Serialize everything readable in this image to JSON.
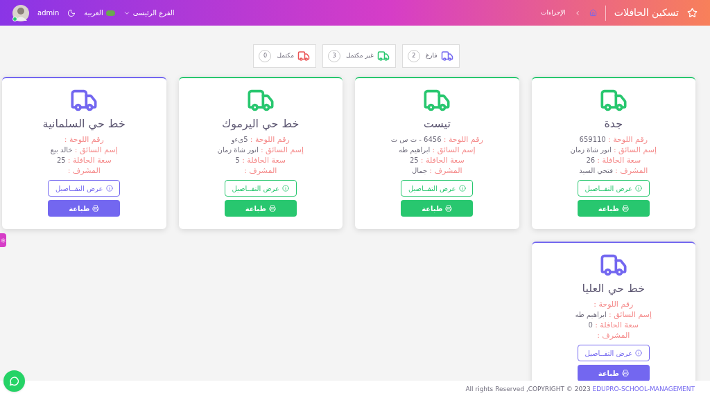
{
  "header": {
    "title": "تسكين الحافلات",
    "breadcrumb": "الإجراءات",
    "branch": "الفرع الرئيسى",
    "language": "العربية",
    "user": "admin"
  },
  "summary": [
    {
      "label": "فارغ",
      "count": "2",
      "color": "#7367f0"
    },
    {
      "label": "غير مكتمل",
      "count": "3",
      "color": "#28c76f"
    },
    {
      "label": "مكتمل",
      "count": "0",
      "color": "#ea5455"
    }
  ],
  "buses": [
    {
      "name": "جدة",
      "color": "#28c76f",
      "fields": [
        {
          "label": "رقم اللوحة :",
          "value": "659110"
        },
        {
          "label": "إسم السائق :",
          "value": "انور شاة زمان"
        },
        {
          "label": "سعة الحافلة :",
          "value": "26"
        },
        {
          "label": "المشرف :",
          "value": "فتحي السيد"
        }
      ],
      "details": "عرض التفــاصيل",
      "print": "طباعة"
    },
    {
      "name": "تيست",
      "color": "#28c76f",
      "fields": [
        {
          "label": "رقم اللوحة :",
          "value": "6456 - ت س ت"
        },
        {
          "label": "إسم السائق :",
          "value": "ابراهيم طه"
        },
        {
          "label": "سعة الحافلة :",
          "value": "25"
        },
        {
          "label": "المشرف :",
          "value": "جمال"
        }
      ],
      "details": "عرض التفــاصيل",
      "print": "طباعة"
    },
    {
      "name": "خط حي اليرموك",
      "color": "#28c76f",
      "fields": [
        {
          "label": "رقم اللوحة :",
          "value": "5ىءو"
        },
        {
          "label": "إسم السائق :",
          "value": "انور شاة زمان"
        },
        {
          "label": "سعة الحافلة :",
          "value": "5"
        },
        {
          "label": "المشرف :"
        }
      ],
      "details": "عرض التفــاصيل",
      "print": "طباعة"
    },
    {
      "name": "خط حي السلمانية",
      "color": "#7367f0",
      "fields": [
        {
          "label": "رقم اللوحة :"
        },
        {
          "label": "إسم السائق :",
          "value": "خالد بيع"
        },
        {
          "label": "سعة الحافلة :",
          "value": "25"
        },
        {
          "label": "المشرف :"
        }
      ],
      "details": "عرض التفــاصيل",
      "print": "طباعة"
    },
    {
      "name": "خط حي العليا",
      "color": "#7367f0",
      "fields": [
        {
          "label": "رقم اللوحة :"
        },
        {
          "label": "إسم السائق :",
          "value": "ابراهيم طه"
        },
        {
          "label": "سعة الحافلة :",
          "value": "0"
        },
        {
          "label": "المشرف :"
        }
      ],
      "details": "عرض التفــاصيل",
      "print": "طباعة"
    }
  ],
  "footer": {
    "text": "All rights Reserved ,COPYRIGHT © 2023",
    "link": "EDUPRO-SCHOOL-MANAGEMENT"
  }
}
